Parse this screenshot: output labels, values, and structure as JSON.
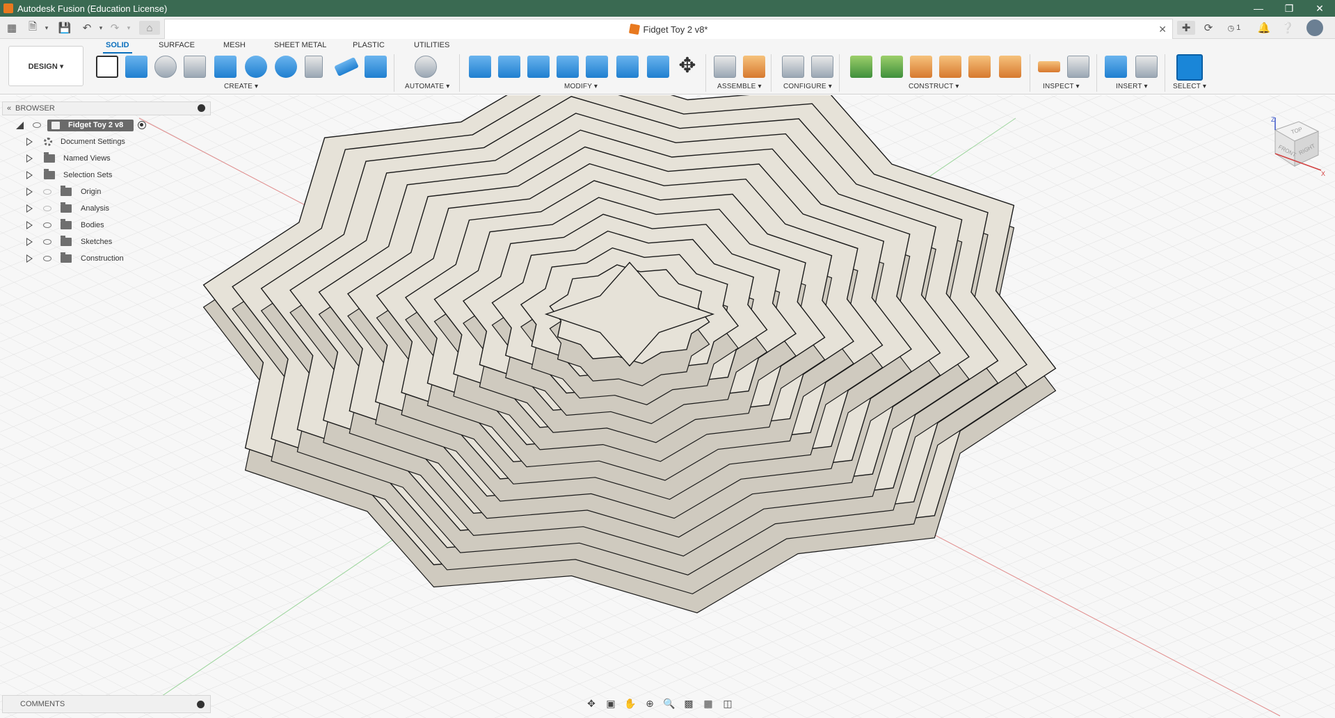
{
  "window": {
    "title": "Autodesk Fusion (Education License)"
  },
  "document": {
    "tab_title": "Fidget Toy 2 v8*",
    "job_count": "1"
  },
  "ribbon": {
    "workspace_label": "DESIGN ▾",
    "tabs": [
      "SOLID",
      "SURFACE",
      "MESH",
      "SHEET METAL",
      "PLASTIC",
      "UTILITIES"
    ],
    "active_tab": "SOLID",
    "groups": {
      "create": "CREATE ▾",
      "automate": "AUTOMATE ▾",
      "modify": "MODIFY ▾",
      "assemble": "ASSEMBLE ▾",
      "configure": "CONFIGURE ▾",
      "construct": "CONSTRUCT ▾",
      "inspect": "INSPECT ▾",
      "insert": "INSERT ▾",
      "select": "SELECT ▾"
    }
  },
  "browser": {
    "title": "BROWSER",
    "root": "Fidget Toy 2 v8",
    "items": [
      {
        "label": "Document Settings",
        "icon": "gear-icon"
      },
      {
        "label": "Named Views",
        "icon": "folder-icon"
      },
      {
        "label": "Selection Sets",
        "icon": "folder-icon"
      },
      {
        "label": "Origin",
        "icon": "folder-icon"
      },
      {
        "label": "Analysis",
        "icon": "folder-icon"
      },
      {
        "label": "Bodies",
        "icon": "folder-icon"
      },
      {
        "label": "Sketches",
        "icon": "folder-icon"
      },
      {
        "label": "Construction",
        "icon": "folder-icon"
      }
    ]
  },
  "comments": {
    "title": "COMMENTS"
  },
  "viewcube": {
    "faces": [
      "TOP",
      "FRONT",
      "RIGHT"
    ],
    "axes": [
      "Z",
      "X"
    ]
  },
  "colors": {
    "titlebar": "#3a6a52",
    "accent": "#0a6fbd",
    "model_face": "#e6e2d8",
    "model_edge": "#1a1a1a"
  }
}
